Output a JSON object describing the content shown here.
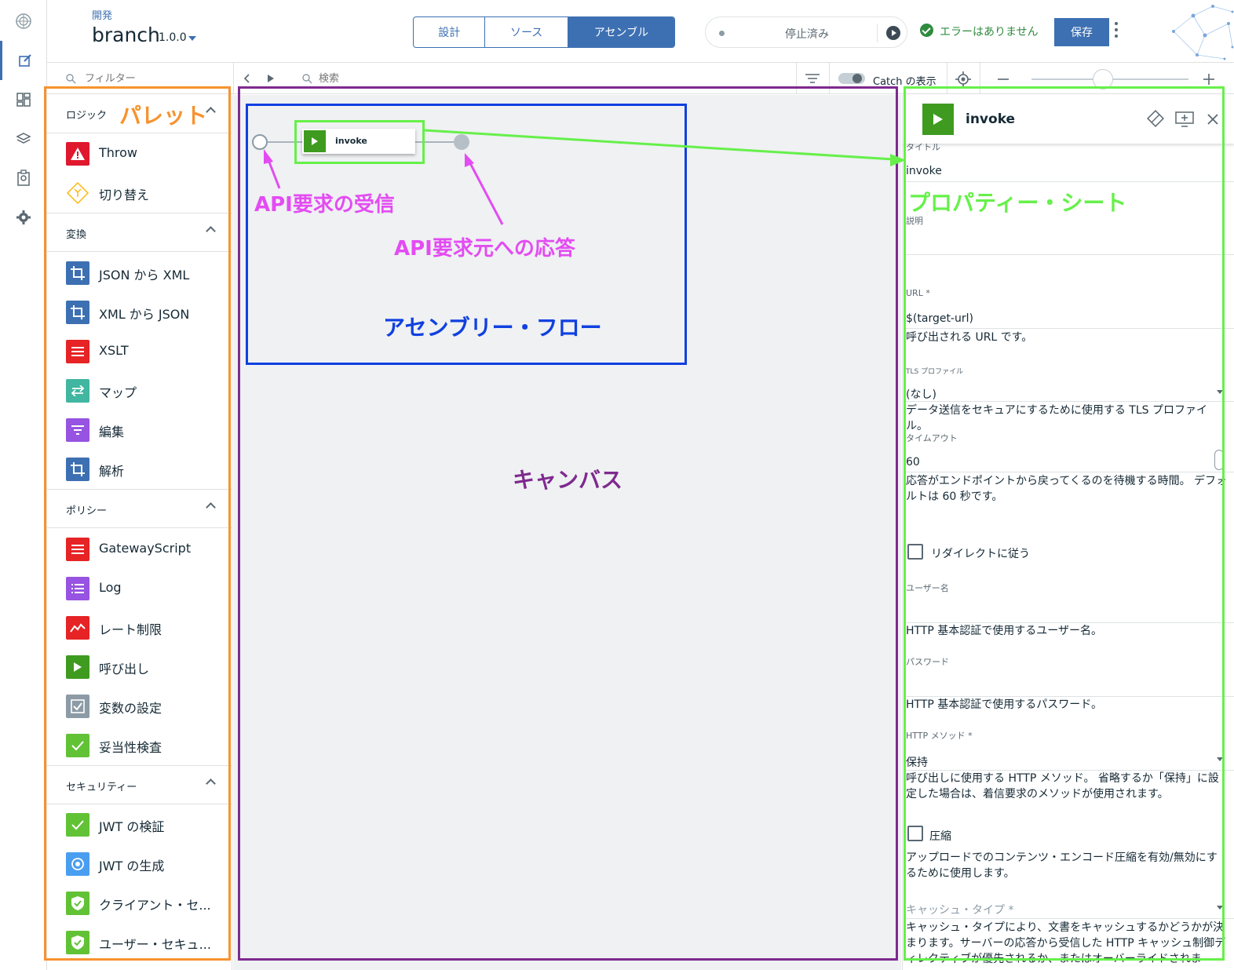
{
  "header": {
    "breadcrumb": "開発",
    "api_name": "branch",
    "api_version": "1.0.0",
    "tabs": [
      {
        "label": "設計",
        "active": false
      },
      {
        "label": "ソース",
        "active": false
      },
      {
        "label": "アセンブル",
        "active": true
      }
    ],
    "test_status": "停止済み",
    "validation_status": "エラーはありません",
    "save_label": "保存"
  },
  "toolbar": {
    "filter_placeholder": "フィルター",
    "search_placeholder": "検索",
    "catch_label": "Catch の表示"
  },
  "palette": {
    "sections": [
      {
        "title": "ロジック",
        "items": [
          {
            "label": "Throw",
            "icon": "warning-icon",
            "color": "#e0182d"
          },
          {
            "label": "切り替え",
            "icon": "switch-icon",
            "color": "#fdd13a"
          }
        ]
      },
      {
        "title": "変換",
        "items": [
          {
            "label": "JSON から XML",
            "icon": "crop-icon",
            "color": "#3d70b2"
          },
          {
            "label": "XML から JSON",
            "icon": "crop-icon",
            "color": "#3d70b2"
          },
          {
            "label": "XSLT",
            "icon": "lines-icon",
            "color": "#e62325"
          },
          {
            "label": "マップ",
            "icon": "arrows-icon",
            "color": "#41d6c3"
          },
          {
            "label": "編集",
            "icon": "filter-icon",
            "color": "#9753e1"
          },
          {
            "label": "解析",
            "icon": "crop-icon",
            "color": "#3d70b2"
          }
        ]
      },
      {
        "title": "ポリシー",
        "items": [
          {
            "label": "GatewayScript",
            "icon": "lines-icon",
            "color": "#e62325"
          },
          {
            "label": "Log",
            "icon": "list-icon",
            "color": "#9753e1"
          },
          {
            "label": "レート制限",
            "icon": "chart-line-icon",
            "color": "#e62325"
          },
          {
            "label": "呼び出し",
            "icon": "play-icon",
            "color": "#3e9b1f"
          },
          {
            "label": "変数の設定",
            "icon": "checkbox-icon",
            "color": "#8c9ba5"
          },
          {
            "label": "妥当性検査",
            "icon": "check-icon",
            "color": "#5aa700"
          }
        ]
      },
      {
        "title": "セキュリティー",
        "items": [
          {
            "label": "JWT の検証",
            "icon": "check-icon",
            "color": "#5aa700"
          },
          {
            "label": "JWT の生成",
            "icon": "target-icon",
            "color": "#4178be"
          },
          {
            "label": "クライアント・セ...",
            "icon": "shield-check-icon",
            "color": "#5aa700"
          },
          {
            "label": "ユーザー・セキュ...",
            "icon": "shield-check-icon",
            "color": "#5aa700"
          }
        ]
      }
    ]
  },
  "canvas": {
    "node_label": "invoke"
  },
  "properties": {
    "title": "invoke",
    "fields": {
      "title_label": "タイトル",
      "title_value": "invoke",
      "description_label": "説明",
      "url_label": "URL *",
      "url_value": "$(target-url)",
      "url_help": "呼び出される URL です。",
      "tls_label": "TLS プロファイル",
      "tls_value": "(なし)",
      "tls_help": "データ送信をセキュアにするために使用する TLS プロファイル。",
      "timeout_label": "タイムアウト",
      "timeout_value": "60",
      "timeout_help": "応答がエンドポイントから戻ってくるのを待機する時間。 デフォルトは 60 秒です。",
      "redirect_label": "リダイレクトに従う",
      "username_label": "ユーザー名",
      "username_help": "HTTP 基本認証で使用するユーザー名。",
      "password_label": "パスワード",
      "password_help": "HTTP 基本認証で使用するパスワード。",
      "method_label": "HTTP メソッド *",
      "method_value": "保持",
      "method_help": "呼び出しに使用する HTTP メソッド。 省略するか「保持」に設定した場合は、着信要求のメソッドが使用されます。",
      "compress_label": "圧縮",
      "compress_help": "アップロードでのコンテンツ・エンコード圧縮を有効/無効にするために使用します。",
      "cache_label": "キャッシュ・タイプ *",
      "cache_help": "キャッシュ・タイプにより、文書をキャッシュするかどうかが決まります。サーバーの応答から受信した HTTP キャッシュ制御ディレクティブが優先されるか、またはオーバーライドされま"
    }
  },
  "annotations": {
    "palette": "パレット",
    "receive": "API要求の受信",
    "respond": "API要求元への応答",
    "flow": "アセンブリー・フロー",
    "canvas": "キャンバス",
    "property_sheet": "プロパティー・シート",
    "colors": {
      "orange": "#f7932f",
      "magenta": "#e34cf2",
      "blue": "#1040e0",
      "purple": "#7e2a8e",
      "green": "#66f04a"
    }
  }
}
